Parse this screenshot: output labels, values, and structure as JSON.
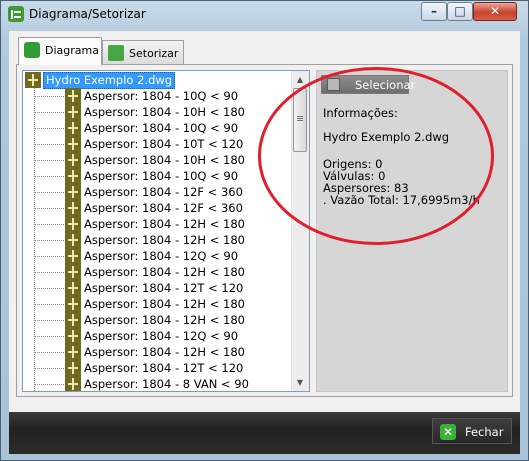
{
  "window": {
    "title": "Diagrama/Setorizar",
    "controls": {
      "minimize": "–",
      "maximize": "□",
      "close": "✕"
    }
  },
  "tabs": [
    {
      "label": "Diagrama",
      "active": true,
      "icon": "diagram-icon"
    },
    {
      "label": "Setorizar",
      "active": false,
      "icon": "sectorize-icon"
    }
  ],
  "tree": {
    "root": "Hydro Exemplo 2.dwg",
    "items": [
      "Aspersor: 1804 - 10Q < 90",
      "Aspersor: 1804 - 10H < 180",
      "Aspersor: 1804 - 10Q < 90",
      "Aspersor: 1804 - 10T < 120",
      "Aspersor: 1804 - 10H < 180",
      "Aspersor: 1804 - 10Q < 90",
      "Aspersor: 1804 - 12F < 360",
      "Aspersor: 1804 - 12F < 360",
      "Aspersor: 1804 - 12H < 180",
      "Aspersor: 1804 - 12H < 180",
      "Aspersor: 1804 - 12Q < 90",
      "Aspersor: 1804 - 12H < 180",
      "Aspersor: 1804 - 12T < 120",
      "Aspersor: 1804 - 12H < 180",
      "Aspersor: 1804 - 12H < 180",
      "Aspersor: 1804 - 12Q < 90",
      "Aspersor: 1804 - 12H < 180",
      "Aspersor: 1804 - 12T < 120",
      "Aspersor: 1804 - 8 VAN < 90"
    ]
  },
  "panel": {
    "select_button": "Selecionar",
    "info_title": "Informações:",
    "file_name": "Hydro Exemplo 2.dwg",
    "origens": "Origens: 0",
    "valvulas": "Válvulas: 0",
    "aspersores": "Aspersores: 83",
    "vazao": ". Vazão Total: 17,6995m3/h",
    "annotation_color": "#e01e2c"
  },
  "footer": {
    "close_button": "Fechar"
  }
}
